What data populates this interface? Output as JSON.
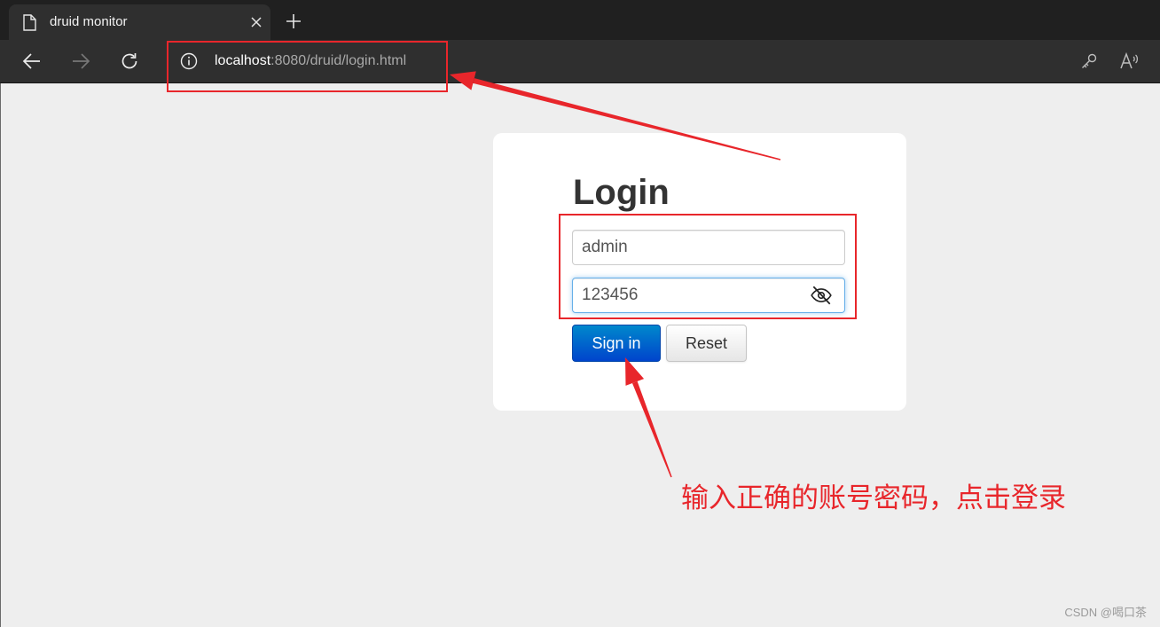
{
  "browser": {
    "tab": {
      "title": "druid monitor",
      "icon": "page-icon",
      "close_icon": "close-icon"
    },
    "new_tab_icon": "plus-icon",
    "nav": {
      "back_icon": "back-arrow-icon",
      "forward_icon": "forward-arrow-icon",
      "refresh_icon": "refresh-icon"
    },
    "address": {
      "site_info_icon": "info-icon",
      "host": "localhost",
      "path": ":8080/druid/login.html"
    },
    "toolbar_icons": [
      "key-icon",
      "read-aloud-icon"
    ]
  },
  "login": {
    "title": "Login",
    "username": {
      "value": "admin"
    },
    "password": {
      "value": "123456",
      "visibility_icon": "eye-slash-icon"
    },
    "sign_in_label": "Sign in",
    "reset_label": "Reset"
  },
  "annotation": {
    "text": "输入正确的账号密码，点击登录"
  },
  "watermark": "CSDN @喝口茶",
  "colors": {
    "annotation_red": "#e8262b",
    "primary_button": "#0066cc",
    "page_background": "#eeeeee",
    "browser_chrome": "#2f2f2f"
  }
}
